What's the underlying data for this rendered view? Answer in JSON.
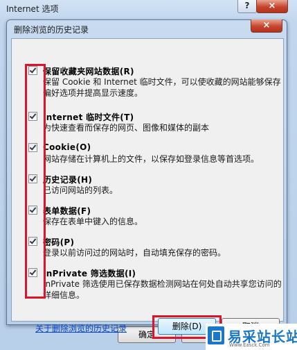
{
  "outer_window": {
    "title": "Internet 选项",
    "help_label": "?",
    "close_label": "×",
    "ok_label": "确定"
  },
  "dialog": {
    "title": "删除浏览的历史记录",
    "close_label": "×",
    "options": [
      {
        "title": "保留收藏夹网站数据(R)",
        "desc": "保留 Cookie 和 Internet 临时文件，可以使收藏的网站能够保存偏好选项并提高显示速度。",
        "checked": true
      },
      {
        "title": "Internet 临时文件(T)",
        "desc": "为快速查看而保存的网页、图像和媒体的副本",
        "checked": true
      },
      {
        "title": "Cookie(O)",
        "desc": "网站存储在计算机上的文件，以保存如登录信息等首选项。",
        "checked": true
      },
      {
        "title": "历史记录(H)",
        "desc": "已访问网站的列表。",
        "checked": true
      },
      {
        "title": "表单数据(F)",
        "desc": "保存在表单中键入的信息。",
        "checked": true
      },
      {
        "title": "密码(P)",
        "desc": "登录以前访问过的网站时，自动填充保存的密码。",
        "checked": true
      },
      {
        "title": "InPrivate 筛选数据(I)",
        "desc": "InPrivate 筛选使用已保存数据检测网站在何处自动共享您访问的详细信息。",
        "checked": true
      }
    ],
    "about_link": "关于删除浏览的历史记录",
    "delete_label": "删除(D)",
    "cancel_label": "取消"
  },
  "watermark": {
    "text": "易采站长站",
    "url": "Www.Easck.Com"
  },
  "colors": {
    "highlight": "#d9142b",
    "link": "#0645c4",
    "close_button": "#c7452d"
  }
}
